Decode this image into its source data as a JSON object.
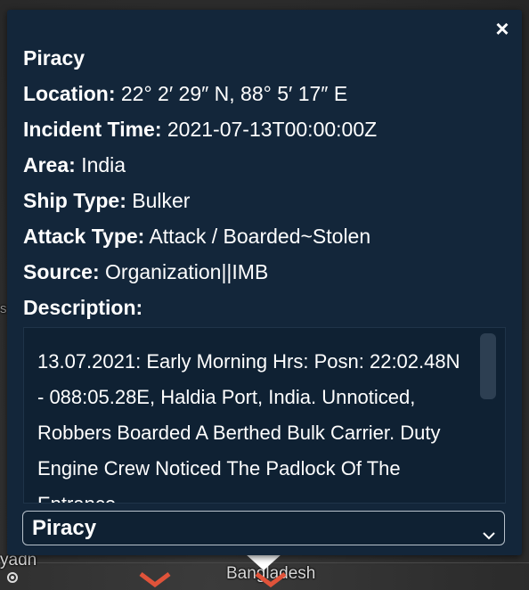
{
  "popup": {
    "close_glyph": "×",
    "title": "Piracy",
    "fields": [
      {
        "key": "Location:",
        "value": "22° 2′ 29″ N, 88° 5′ 17″ E"
      },
      {
        "key": "Incident Time:",
        "value": "2021-07-13T00:00:00Z"
      },
      {
        "key": "Area:",
        "value": "India"
      },
      {
        "key": "Ship Type:",
        "value": "Bulker"
      },
      {
        "key": "Attack Type:",
        "value": "Attack / Boarded~Stolen"
      },
      {
        "key": "Source:",
        "value": "Organization||IMB"
      }
    ],
    "description_label": "Description:",
    "description": "13.07.2021: Early Morning Hrs: Posn: 22:02.48N - 088:05.28E, Haldia Port, India. Unnoticed, Robbers Boarded A Berthed Bulk Carrier. Duty Engine Crew Noticed The Padlock Of The Entrance",
    "category_select": {
      "selected": "Piracy"
    }
  },
  "map": {
    "labels": {
      "left": "yadn",
      "bangladesh": "Bangladesh",
      "edge": "s"
    }
  },
  "colors": {
    "popup_bg": "#13263a",
    "desc_bg": "#0f2133",
    "marker": "#e0533a"
  },
  "icons": [
    "close-icon",
    "chevron-down-icon",
    "incident-marker-icon",
    "location-dot-icon"
  ]
}
